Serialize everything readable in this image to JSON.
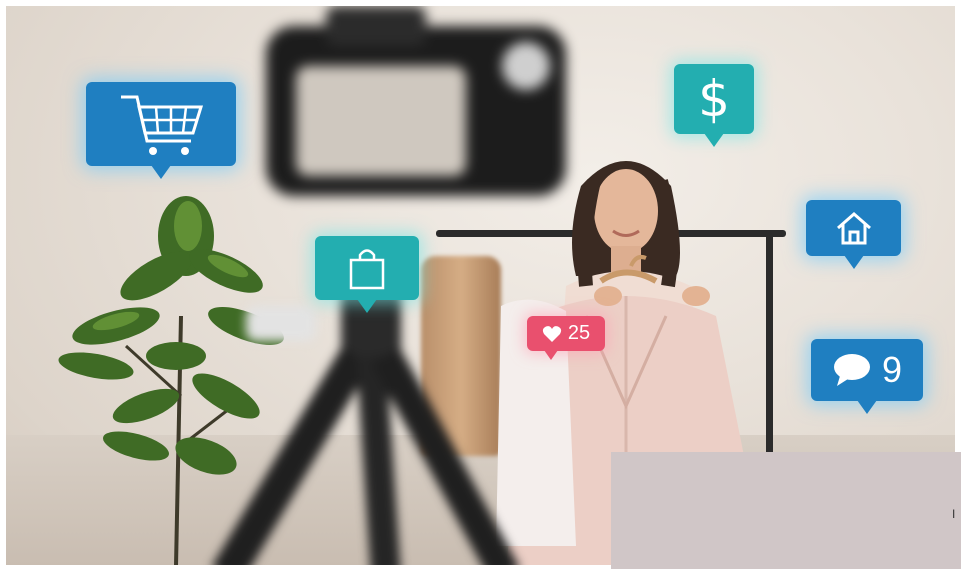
{
  "icons": {
    "cart": "shopping-cart-icon",
    "dollar": "dollar-sign",
    "home": "home-icon",
    "bag": "shopping-bag-icon",
    "like": "heart-icon",
    "comment": "speech-bubble-icon"
  },
  "social": {
    "dollar_symbol": "$",
    "likes_count": "25",
    "comments_count": "9"
  },
  "overlay": {
    "cut_off_text": "I"
  },
  "colors": {
    "icon_blue": "#1f7fc1",
    "icon_teal": "#23aeb0",
    "like_pink": "#e9506e",
    "overlay_panel": "#d0c6c7"
  }
}
